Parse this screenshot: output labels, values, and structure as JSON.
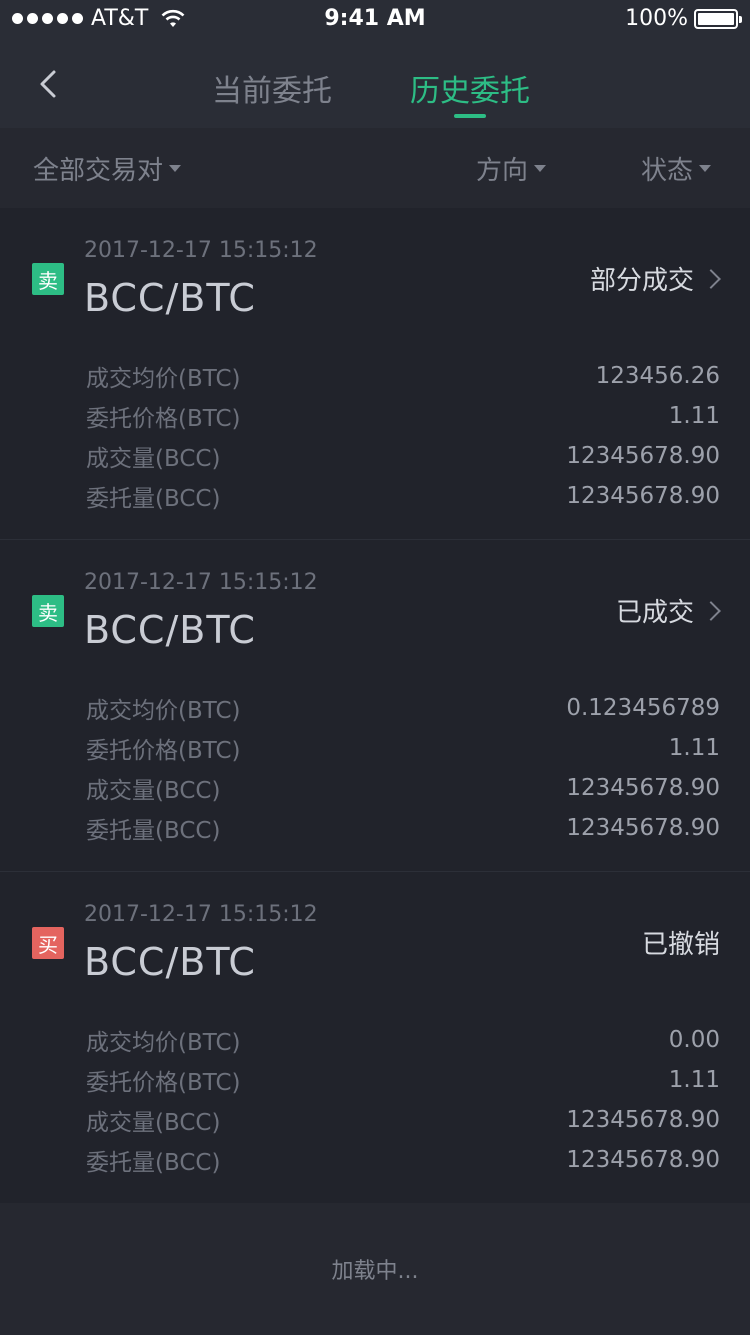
{
  "status_bar": {
    "carrier": "AT&T",
    "time": "9:41 AM",
    "battery": "100%",
    "battery_level": 1.0
  },
  "nav": {
    "back_icon": "chevron-left-icon",
    "tabs": [
      {
        "label": "当前委托",
        "active": false
      },
      {
        "label": "历史委托",
        "active": true
      }
    ],
    "active_color": "#2dbd85"
  },
  "filters": {
    "pair": "全部交易对",
    "direction": "方向",
    "status": "状态"
  },
  "orders": [
    {
      "side": "卖",
      "side_type": "sell",
      "time": "2017-12-17 15:15:12",
      "pair": "BCC/BTC",
      "status": "部分成交",
      "has_detail": true,
      "rows": [
        {
          "label": "成交均价(BTC)",
          "value": "123456.26"
        },
        {
          "label": "委托价格(BTC)",
          "value": "1.11"
        },
        {
          "label": "成交量(BCC)",
          "value": "12345678.90"
        },
        {
          "label": "委托量(BCC)",
          "value": "12345678.90"
        }
      ]
    },
    {
      "side": "卖",
      "side_type": "sell",
      "time": "2017-12-17 15:15:12",
      "pair": "BCC/BTC",
      "status": "已成交",
      "has_detail": true,
      "rows": [
        {
          "label": "成交均价(BTC)",
          "value": "0.123456789"
        },
        {
          "label": "委托价格(BTC)",
          "value": "1.11"
        },
        {
          "label": "成交量(BCC)",
          "value": "12345678.90"
        },
        {
          "label": "委托量(BCC)",
          "value": "12345678.90"
        }
      ]
    },
    {
      "side": "买",
      "side_type": "buy",
      "time": "2017-12-17 15:15:12",
      "pair": "BCC/BTC",
      "status": "已撤销",
      "has_detail": false,
      "rows": [
        {
          "label": "成交均价(BTC)",
          "value": "0.00"
        },
        {
          "label": "委托价格(BTC)",
          "value": "1.11"
        },
        {
          "label": "成交量(BCC)",
          "value": "12345678.90"
        },
        {
          "label": "委托量(BCC)",
          "value": "12345678.90"
        }
      ]
    }
  ],
  "loading_text": "加载中..."
}
